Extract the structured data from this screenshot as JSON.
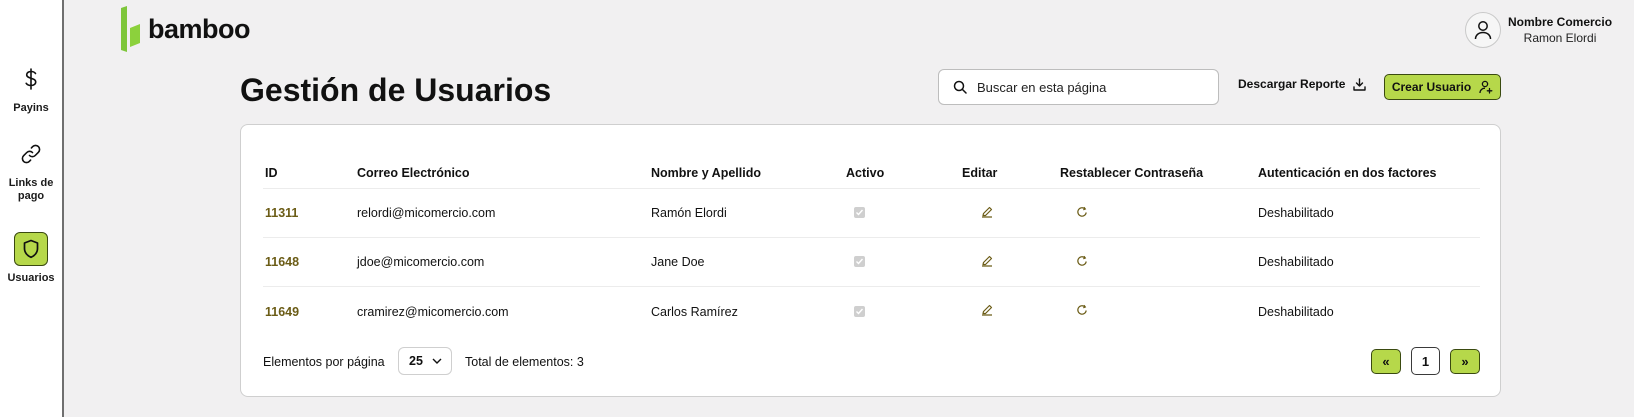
{
  "brand": {
    "name": "bamboo",
    "accent": "#b6d84a"
  },
  "sidebar": {
    "items": [
      {
        "label": "Payins",
        "icon": "dollar-icon"
      },
      {
        "label": "Links de pago",
        "icon": "link-icon"
      },
      {
        "label": "Usuarios",
        "icon": "shield-icon",
        "active": true
      }
    ]
  },
  "profile": {
    "name": "Nombre Comercio",
    "user": "Ramon Elordi"
  },
  "page": {
    "title": "Gestión de Usuarios"
  },
  "search": {
    "placeholder": "Buscar en esta página"
  },
  "actions": {
    "download_label": "Descargar Reporte",
    "create_label": "Crear Usuario"
  },
  "table": {
    "headers": {
      "id": "ID",
      "email": "Correo Electrónico",
      "name": "Nombre y Apellido",
      "active": "Activo",
      "edit": "Editar",
      "reset": "Restablecer Contraseña",
      "twofa": "Autenticación en dos factores"
    },
    "rows": [
      {
        "id": "11311",
        "email": "relordi@micomercio.com",
        "name": "Ramón Elordi",
        "active": true,
        "twofa": "Deshabilitado"
      },
      {
        "id": "11648",
        "email": "jdoe@micomercio.com",
        "name": "Jane Doe",
        "active": true,
        "twofa": "Deshabilitado"
      },
      {
        "id": "11649",
        "email": "cramirez@micomercio.com",
        "name": "Carlos Ramírez",
        "active": true,
        "twofa": "Deshabilitado"
      }
    ]
  },
  "pagination": {
    "per_page_label": "Elementos por página",
    "per_page_value": "25",
    "total_label": "Total de elementos: 3",
    "first_label": "«",
    "current_page": "1",
    "next_label": "»"
  }
}
